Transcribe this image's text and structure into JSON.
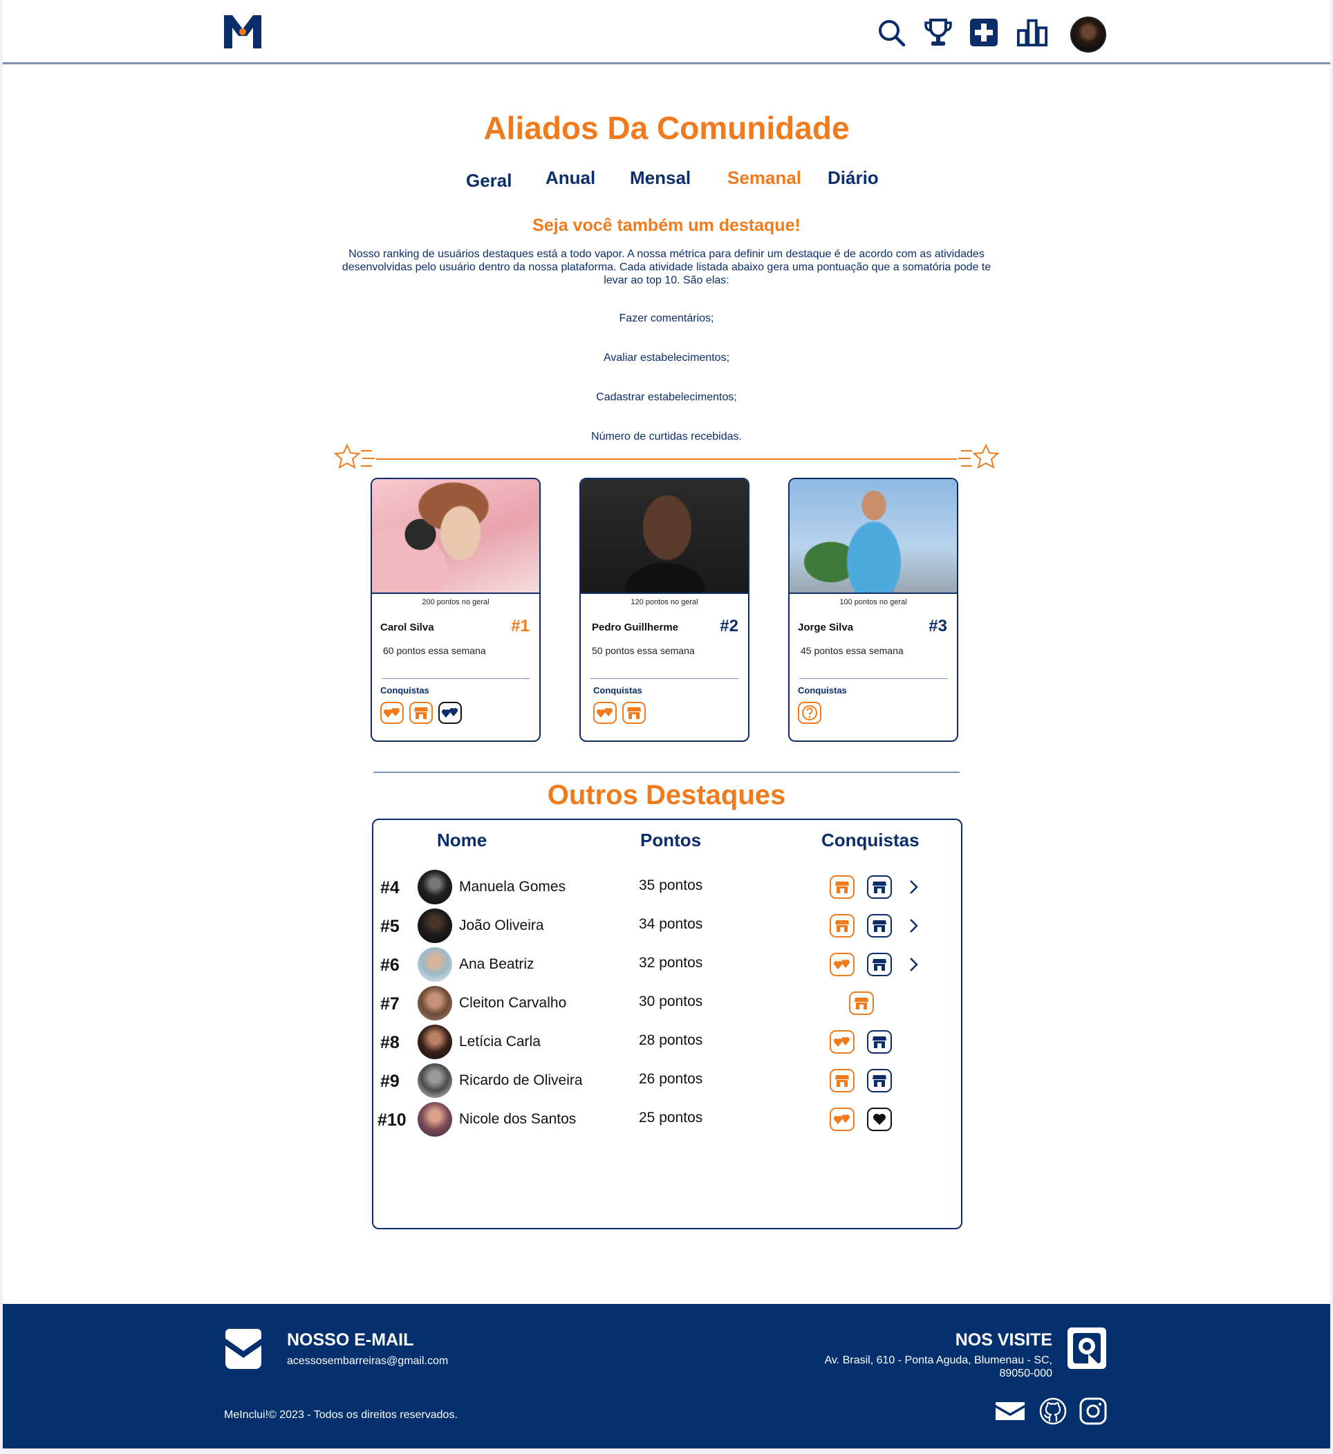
{
  "header": {
    "logo_icon": "meinclui-logo",
    "nav_icons": [
      "search-icon",
      "trophy-icon",
      "add-icon",
      "ranking-icon"
    ],
    "avatar_icon": "user-avatar"
  },
  "page": {
    "title": "Aliados Da Comunidade",
    "tabs": [
      {
        "label": "Geral",
        "active": false
      },
      {
        "label": "Anual",
        "active": false
      },
      {
        "label": "Mensal",
        "active": false
      },
      {
        "label": "Semanal",
        "active": true
      },
      {
        "label": "Diário",
        "active": false
      }
    ],
    "subtitle": "Seja você também um destaque!",
    "intro": "Nosso ranking de usuários destaques está a todo vapor. A nossa métrica para definir um destaque é de acordo com as atividades desenvolvidas pelo usuário dentro da nossa plataforma. Cada atividade listada abaixo gera uma pontuação que a somatória pode te levar ao top 10. São elas:",
    "activities": [
      "Fazer comentários;",
      "Avaliar estabelecimentos;",
      "Cadastrar estabelecimentos;",
      "Número de curtidas recebidas."
    ]
  },
  "top3": [
    {
      "name": "Carol Silva",
      "rank": "#1",
      "rank_color": "#f07a1c",
      "general_points": "200 pontos no geral",
      "week_points": "60 pontos essa semana",
      "achievements_label": "Conquistas",
      "badges": [
        "hearts-icon",
        "store-icon",
        "hearts-blue-icon"
      ]
    },
    {
      "name": "Pedro Guillherme",
      "rank": "#2",
      "rank_color": "#0b2e6b",
      "general_points": "120 pontos no geral",
      "week_points": "50 pontos essa semana",
      "achievements_label": "Conquistas",
      "badges": [
        "hearts-icon",
        "store-icon"
      ]
    },
    {
      "name": "Jorge Silva",
      "rank": "#3",
      "rank_color": "#0b2e6b",
      "general_points": "100 pontos no geral",
      "week_points": "45 pontos essa semana",
      "achievements_label": "Conquistas",
      "badges": [
        "question-icon"
      ]
    }
  ],
  "others": {
    "title": "Outros Destaques",
    "headers": {
      "name": "Nome",
      "points": "Pontos",
      "achievements": "Conquistas"
    },
    "rows": [
      {
        "rank": "#4",
        "name": "Manuela Gomes",
        "points": "35 pontos"
      },
      {
        "rank": "#5",
        "name": "João Oliveira",
        "points": "34 pontos"
      },
      {
        "rank": "#6",
        "name": "Ana Beatriz",
        "points": "32 pontos"
      },
      {
        "rank": "#7",
        "name": "Cleiton Carvalho",
        "points": "30 pontos"
      },
      {
        "rank": "#8",
        "name": "Letícia Carla",
        "points": "28 pontos"
      },
      {
        "rank": "#9",
        "name": "Ricardo de Oliveira",
        "points": "26 pontos"
      },
      {
        "rank": "#10",
        "name": "Nicole dos Santos",
        "points": "25 pontos"
      }
    ]
  },
  "footer": {
    "email_title": "NOSSO E-MAIL",
    "email": "acessosembarreiras@gmail.com",
    "visit_title": "NOS VISITE",
    "address": "Av. Brasil, 610 - Ponta Aguda, Blumenau - SC, 89050-000",
    "copyright": "MeInclui!© 2023 - Todos os direitos reservados.",
    "social_icons": [
      "mail-icon",
      "github-icon",
      "instagram-icon"
    ]
  },
  "colors": {
    "orange": "#f07a1c",
    "navy": "#0b2e6b",
    "footer_bg": "#04306e"
  }
}
